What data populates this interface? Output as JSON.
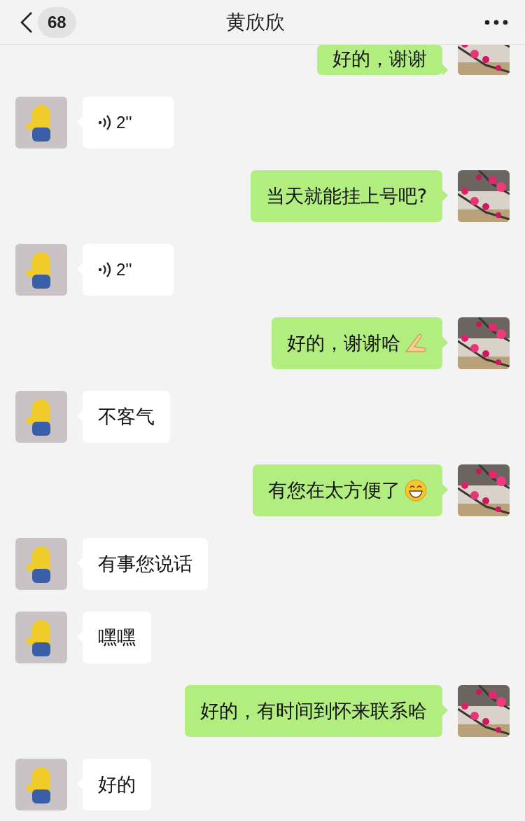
{
  "header": {
    "back_count": "68",
    "title": "黄欣欣"
  },
  "messages": [
    {
      "outgoing": true,
      "kind": "text",
      "parts": [
        {
          "kind": "text",
          "text": "好的，谢谢"
        }
      ]
    },
    {
      "outgoing": false,
      "kind": "voice",
      "duration": "2''"
    },
    {
      "outgoing": true,
      "kind": "text",
      "parts": [
        {
          "kind": "text",
          "text": "当天就能挂上号吧?"
        }
      ]
    },
    {
      "outgoing": false,
      "kind": "voice",
      "duration": "2''"
    },
    {
      "outgoing": true,
      "kind": "text",
      "parts": [
        {
          "kind": "text",
          "text": "好的，谢谢哈"
        },
        {
          "kind": "hand"
        }
      ]
    },
    {
      "outgoing": false,
      "kind": "text",
      "parts": [
        {
          "kind": "text",
          "text": "不客气"
        }
      ]
    },
    {
      "outgoing": true,
      "kind": "text",
      "parts": [
        {
          "kind": "text",
          "text": "有您在太方便了"
        },
        {
          "kind": "grin"
        }
      ]
    },
    {
      "outgoing": false,
      "kind": "text",
      "parts": [
        {
          "kind": "text",
          "text": "有事您说话"
        }
      ]
    },
    {
      "outgoing": false,
      "kind": "text",
      "parts": [
        {
          "kind": "text",
          "text": "嘿嘿"
        }
      ]
    },
    {
      "outgoing": true,
      "kind": "text",
      "parts": [
        {
          "kind": "text",
          "text": "好的，有时间到怀来联系哈"
        }
      ]
    },
    {
      "outgoing": false,
      "kind": "text",
      "parts": [
        {
          "kind": "text",
          "text": "好的"
        }
      ]
    }
  ]
}
